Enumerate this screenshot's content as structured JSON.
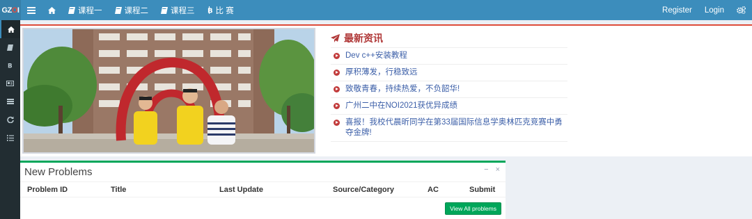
{
  "brand": {
    "logo_pre": "GZ",
    "logo_mid": "O",
    "logo_post": "I"
  },
  "nav": {
    "course1": "课程一",
    "course2": "课程二",
    "course3": "课程三",
    "contest": "比 赛",
    "register": "Register",
    "login": "Login"
  },
  "sidebar": {
    "items": [
      {
        "icon": "home-icon"
      },
      {
        "icon": "book-icon"
      },
      {
        "icon": "bitcoin-icon"
      },
      {
        "icon": "id-card-icon"
      },
      {
        "icon": "list-icon"
      },
      {
        "icon": "refresh-icon"
      },
      {
        "icon": "list-ol-icon"
      }
    ]
  },
  "news": {
    "title": "最新资讯",
    "items": [
      "Dev c++安装教程",
      "厚积薄发，行稳致远",
      "致敬青春，持续热爱，不负韶华!",
      "广州二中在NOI2021获优异成绩",
      "喜报！我校代晨昕同学在第33届国际信息学奥林匹克竞赛中勇夺金牌!"
    ]
  },
  "problems": {
    "title": "New Problems",
    "minimize": "−",
    "close": "×",
    "columns": [
      "Problem ID",
      "Title",
      "Last Update",
      "Source/Category",
      "AC",
      "Submit"
    ],
    "view_all": "View All problems"
  },
  "colors": {
    "navbar": "#3c8dbc",
    "sidebar": "#222d32",
    "accent_red": "#dd4b39",
    "success_green": "#00a65a",
    "news_title": "#b03838",
    "link": "#3c5fa8"
  }
}
